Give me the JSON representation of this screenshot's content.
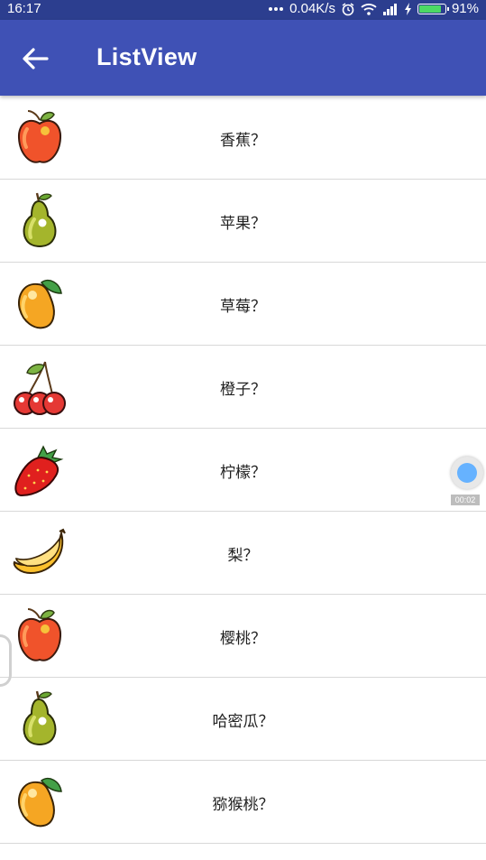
{
  "status_bar": {
    "time": "16:17",
    "network_speed": "0.04K/s",
    "battery_percent": "91%",
    "battery_level": 0.91,
    "icons": [
      "more-dots-icon",
      "alarm-icon",
      "wifi-icon",
      "signal-icon",
      "charging-icon",
      "battery-icon"
    ]
  },
  "app_bar": {
    "title": "ListView",
    "back_icon": "arrow-back-icon",
    "color": "#3f51b5"
  },
  "list": {
    "items": [
      {
        "label": "香蕉？",
        "icon": "apple-icon"
      },
      {
        "label": "苹果？",
        "icon": "pear-icon"
      },
      {
        "label": "草莓？",
        "icon": "mango-icon"
      },
      {
        "label": "橙子？",
        "icon": "cherry-icon"
      },
      {
        "label": "柠檬？",
        "icon": "strawberry-icon"
      },
      {
        "label": "梨？",
        "icon": "banana-icon"
      },
      {
        "label": "樱桃？",
        "icon": "apple-icon"
      },
      {
        "label": "哈密瓜？",
        "icon": "pear-icon"
      },
      {
        "label": "猕猴桃？",
        "icon": "mango-icon"
      }
    ]
  },
  "recorder": {
    "time": "00:02",
    "color": "#66b2ff"
  }
}
